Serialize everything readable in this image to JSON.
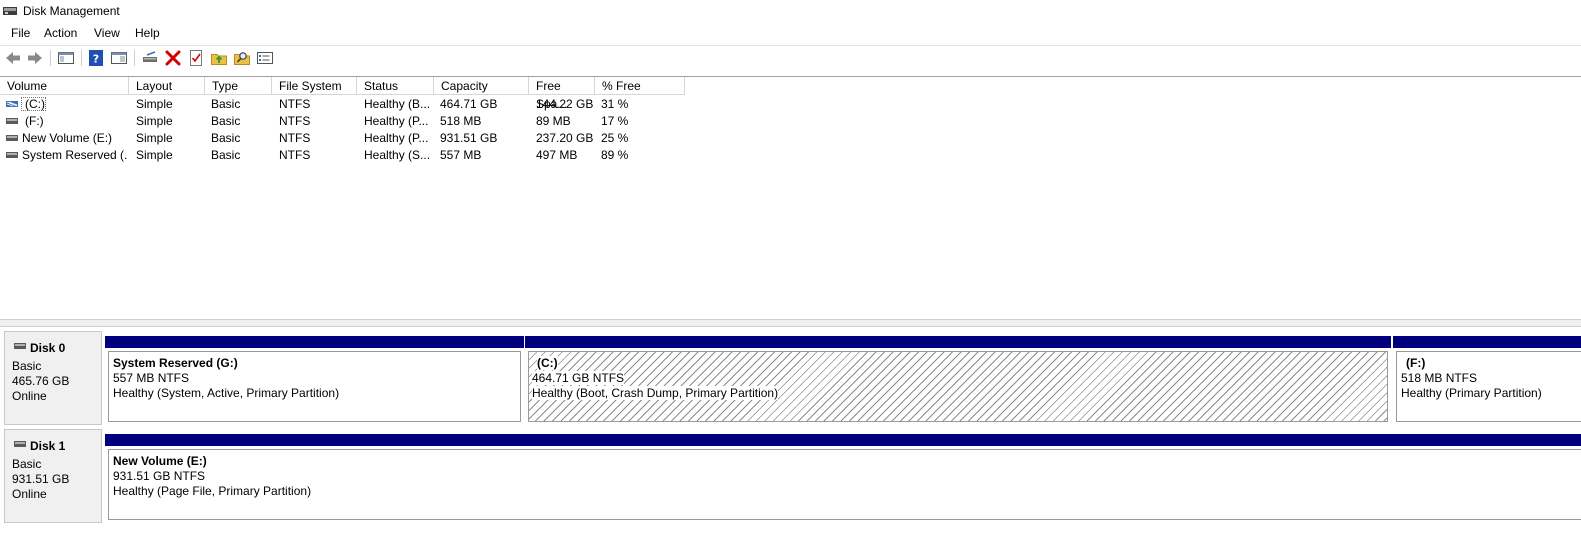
{
  "window": {
    "title": "Disk Management"
  },
  "menu": [
    "File",
    "Action",
    "View",
    "Help"
  ],
  "toolbar": {
    "icons": [
      "back-icon",
      "forward-icon",
      "show-hide-console-tree-icon",
      "help-icon",
      "properties-icon",
      "connect-drive-icon",
      "delete-icon",
      "checklist-icon",
      "import-icon",
      "search-icon",
      "view-list-icon"
    ],
    "colors": {
      "delete": "#d40000",
      "help": "#1f4fb3",
      "folder": "#e8c04a"
    }
  },
  "volumes": {
    "columns": [
      "Volume",
      "Layout",
      "Type",
      "File System",
      "Status",
      "Capacity",
      "Free Spa...",
      "% Free"
    ],
    "rows": [
      {
        "volume": "(C:)",
        "layout": "Simple",
        "type": "Basic",
        "fs": "NTFS",
        "status": "Healthy (B...",
        "capacity": "464.71 GB",
        "free": "144.22 GB",
        "pct": "31 %"
      },
      {
        "volume": "(F:)",
        "layout": "Simple",
        "type": "Basic",
        "fs": "NTFS",
        "status": "Healthy (P...",
        "capacity": "518 MB",
        "free": "89 MB",
        "pct": "17 %"
      },
      {
        "volume": "New Volume (E:)",
        "layout": "Simple",
        "type": "Basic",
        "fs": "NTFS",
        "status": "Healthy (P...",
        "capacity": "931.51 GB",
        "free": "237.20 GB",
        "pct": "25 %"
      },
      {
        "volume": "System Reserved (...",
        "layout": "Simple",
        "type": "Basic",
        "fs": "NTFS",
        "status": "Healthy (S...",
        "capacity": "557 MB",
        "free": "497 MB",
        "pct": "89 %"
      }
    ]
  },
  "disks": [
    {
      "name": "Disk 0",
      "kind": "Basic",
      "size": "465.76 GB",
      "state": "Online",
      "partitions": [
        {
          "title": "System Reserved  (G:)",
          "size": "557 MB NTFS",
          "status": "Healthy (System, Active, Primary Partition)",
          "hatched": false
        },
        {
          "title": "(C:)",
          "size": "464.71 GB NTFS",
          "status": "Healthy (Boot, Crash Dump, Primary Partition)",
          "hatched": true
        },
        {
          "title": "(F:)",
          "size": "518 MB NTFS",
          "status": "Healthy (Primary Partition)",
          "hatched": false
        }
      ]
    },
    {
      "name": "Disk 1",
      "kind": "Basic",
      "size": "931.51 GB",
      "state": "Online",
      "partitions": [
        {
          "title": "New Volume  (E:)",
          "size": "931.51 GB NTFS",
          "status": "Healthy (Page File, Primary Partition)",
          "hatched": false
        }
      ]
    }
  ],
  "colors": {
    "partition_bar": "#00007f",
    "disk_label_bg": "#f0f0f0"
  }
}
